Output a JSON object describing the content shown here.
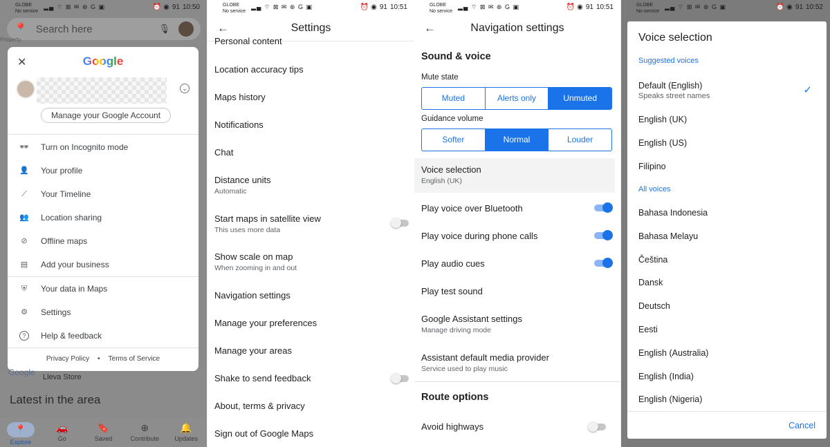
{
  "status": {
    "carrier": "GLOBE",
    "service": "No service",
    "battery": "91",
    "times": [
      "10:50",
      "10:51",
      "10:51",
      "10:52"
    ]
  },
  "panel1": {
    "search_placeholder": "Search here",
    "map_label": "Property",
    "google_logo": "Google",
    "manage_account": "Manage your Google Account",
    "menu": [
      {
        "icon": "incognito-icon",
        "glyph": "🕶",
        "label": "Turn on Incognito mode"
      },
      {
        "icon": "person-icon",
        "glyph": "👤",
        "label": "Your profile"
      },
      {
        "icon": "timeline-icon",
        "glyph": "⟋",
        "label": "Your Timeline"
      },
      {
        "icon": "location-sharing-icon",
        "glyph": "👥",
        "label": "Location sharing"
      },
      {
        "icon": "offline-maps-icon",
        "glyph": "⊘",
        "label": "Offline maps"
      },
      {
        "icon": "business-icon",
        "glyph": "▤",
        "label": "Add your business"
      },
      {
        "icon": "shield-icon",
        "glyph": "⛨",
        "label": "Your data in Maps"
      },
      {
        "icon": "gear-icon",
        "glyph": "⚙",
        "label": "Settings"
      },
      {
        "icon": "help-icon",
        "glyph": "?",
        "label": "Help & feedback"
      }
    ],
    "footer": {
      "privacy": "Privacy Policy",
      "dot": "•",
      "terms": "Terms of Service"
    },
    "map_google": "Google",
    "store_label": "Lleva Store",
    "latest": "Latest in the area",
    "bottom_nav": [
      "Explore",
      "Go",
      "Saved",
      "Contribute",
      "Updates"
    ]
  },
  "panel2": {
    "title": "Settings",
    "items": [
      {
        "title": "Personal content",
        "sub": ""
      },
      {
        "title": "Location accuracy tips",
        "sub": ""
      },
      {
        "title": "Maps history",
        "sub": ""
      },
      {
        "title": "Notifications",
        "sub": ""
      },
      {
        "title": "Chat",
        "sub": ""
      },
      {
        "title": "Distance units",
        "sub": "Automatic"
      },
      {
        "title": "Start maps in satellite view",
        "sub": "This uses more data"
      },
      {
        "title": "Show scale on map",
        "sub": "When zooming in and out"
      },
      {
        "title": "Navigation settings",
        "sub": ""
      },
      {
        "title": "Manage your preferences",
        "sub": ""
      },
      {
        "title": "Manage your areas",
        "sub": ""
      },
      {
        "title": "Shake to send feedback",
        "sub": ""
      },
      {
        "title": "About, terms & privacy",
        "sub": ""
      },
      {
        "title": "Sign out of Google Maps",
        "sub": ""
      }
    ]
  },
  "panel3": {
    "title": "Navigation settings",
    "sound_voice": "Sound & voice",
    "mute_state": "Mute state",
    "mute_options": [
      "Muted",
      "Alerts only",
      "Unmuted"
    ],
    "mute_selected": "Unmuted",
    "guidance_volume": "Guidance volume",
    "volume_options": [
      "Softer",
      "Normal",
      "Louder"
    ],
    "volume_selected": "Normal",
    "voice_selection": {
      "title": "Voice selection",
      "sub": "English (UK)"
    },
    "bluetooth": "Play voice over Bluetooth",
    "phone_calls": "Play voice during phone calls",
    "audio_cues": "Play audio cues",
    "test_sound": "Play test sound",
    "assistant": {
      "title": "Google Assistant settings",
      "sub": "Manage driving mode"
    },
    "media": {
      "title": "Assistant default media provider",
      "sub": "Service used to play music"
    },
    "route_options": "Route options",
    "avoid_highways": "Avoid highways"
  },
  "panel4": {
    "title": "Voice selection",
    "suggested": "Suggested voices",
    "default_voice": {
      "title": "Default (English)",
      "sub": "Speaks street names"
    },
    "suggested_list": [
      "English (UK)",
      "English (US)",
      "Filipino"
    ],
    "all_voices": "All voices",
    "all_list": [
      "Bahasa Indonesia",
      "Bahasa Melayu",
      "Čeština",
      "Dansk",
      "Deutsch",
      "Eesti",
      "English (Australia)",
      "English (India)",
      "English (Nigeria)"
    ],
    "cancel": "Cancel"
  }
}
